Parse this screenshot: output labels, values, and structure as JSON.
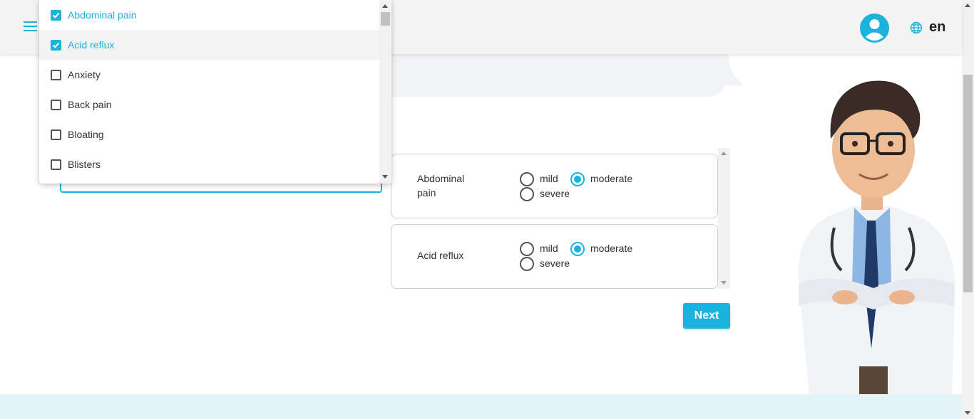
{
  "header": {
    "menu_icon": "hamburger-menu-icon",
    "avatar_icon": "user-avatar-icon",
    "language_icon": "globe-icon",
    "language": "en"
  },
  "symptom_dropdown": {
    "options": [
      {
        "label": "Abdominal pain",
        "checked": true
      },
      {
        "label": "Acid reflux",
        "checked": true
      },
      {
        "label": "Anxiety",
        "checked": false
      },
      {
        "label": "Back pain",
        "checked": false
      },
      {
        "label": "Bloating",
        "checked": false
      },
      {
        "label": "Blisters",
        "checked": false
      }
    ]
  },
  "severity": {
    "items": [
      {
        "symptom": "Abdominal pain",
        "options": [
          "mild",
          "moderate",
          "severe"
        ],
        "selected": "moderate"
      },
      {
        "symptom": "Acid reflux",
        "options": [
          "mild",
          "moderate",
          "severe"
        ],
        "selected": "moderate"
      }
    ]
  },
  "next_button": "Next",
  "colors": {
    "accent": "#1ab3dd",
    "header_bg": "#f4f4f4",
    "footer_bg": "#e2f4f8"
  }
}
